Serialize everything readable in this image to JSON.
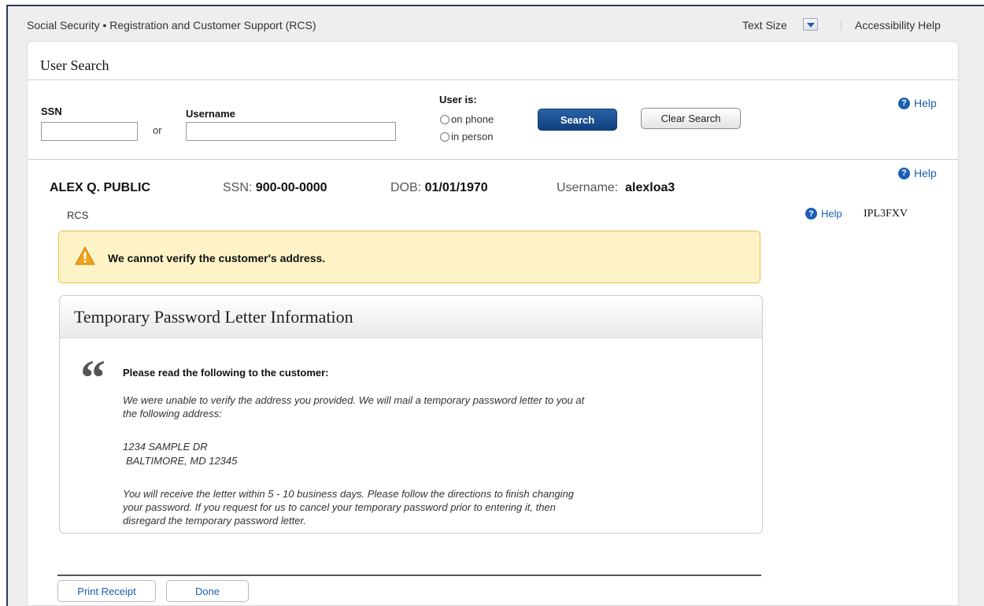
{
  "header": {
    "app_title": "Social Security • Registration and Customer Support (RCS)",
    "text_size_label": "Text Size",
    "accessibility_help": "Accessibility Help"
  },
  "panel": {
    "title": "User Search"
  },
  "search": {
    "ssn_label": "SSN",
    "ssn_value": "",
    "or_label": "or",
    "username_label": "Username",
    "username_value": "",
    "user_is_label": "User is:",
    "radio_options": [
      "on phone",
      "in person"
    ],
    "search_button": "Search",
    "clear_button": "Clear Search",
    "help": "Help"
  },
  "customer": {
    "name": "ALEX Q. PUBLIC",
    "ssn_key": "SSN:",
    "ssn_value": "900-00-0000",
    "dob_key": "DOB:",
    "dob_value": "01/01/1970",
    "username_key": "Username:",
    "username_value": "alexloa3",
    "help": "Help",
    "rcs_label": "RCS",
    "help2": "Help",
    "code": "IPL3FXV"
  },
  "warning": {
    "text": "We cannot verify the customer's address."
  },
  "letter": {
    "title": "Temporary Password Letter Information",
    "quote_glyph": "“",
    "read_line": "Please read the following to the customer:",
    "paragraph1_line1": "We were unable to verify the address you provided.  We will mail a temporary password letter to you at",
    "paragraph1_line2": "the following address:",
    "address_line1": "1234 SAMPLE DR",
    "address_line2": "BALTIMORE, MD 12345",
    "paragraph2_line1": "You will receive the letter within 5 - 10 business days. Please follow the directions to finish changing",
    "paragraph2_line2": "your password. If you request for us to cancel your temporary password prior to entering it, then",
    "paragraph2_line3": "disregard the temporary password letter."
  },
  "actions": {
    "print_receipt": "Print Receipt",
    "done": "Done"
  },
  "colors": {
    "primary_blue": "#1a5fb4",
    "warning_bg": "#fdf3c6",
    "warning_border": "#e5c04e",
    "button_navy": "#0f3f7c"
  }
}
